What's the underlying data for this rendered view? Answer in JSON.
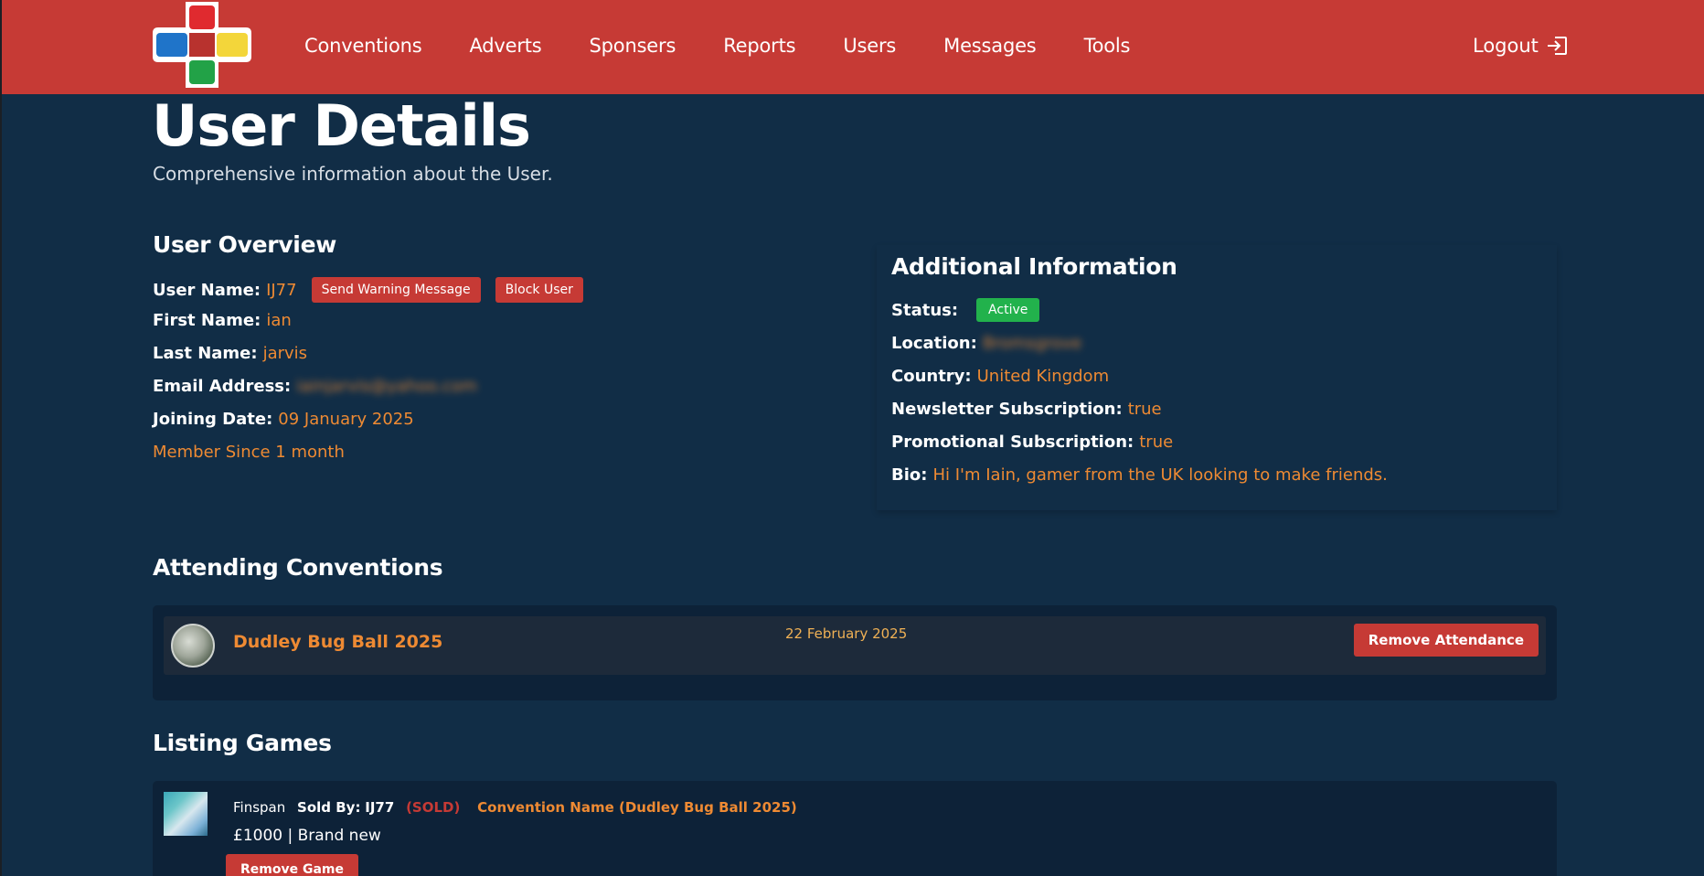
{
  "colors": {
    "header_bg": "#c63a35",
    "page_bg": "#112d46",
    "accent_orange": "#ee8a33",
    "active_green": "#22b24c",
    "button_red": "#c63a35"
  },
  "nav": {
    "items": [
      "Conventions",
      "Adverts",
      "Sponsers",
      "Reports",
      "Users",
      "Messages",
      "Tools"
    ],
    "logout_label": "Logout",
    "logout_icon": "logout-icon"
  },
  "page": {
    "title": "User Details",
    "subtitle": "Comprehensive information about the User."
  },
  "overview": {
    "heading": "User Overview",
    "username_label": "User Name:",
    "username": "IJ77",
    "send_warning_label": "Send Warning Message",
    "block_label": "Block User",
    "first_name_label": "First Name:",
    "first_name": "ian",
    "last_name_label": "Last Name:",
    "last_name": "jarvis",
    "email_label": "Email Address:",
    "email": "iainjarvis@yahoo.com",
    "joining_label": "Joining Date:",
    "joining_date": "09 January 2025",
    "member_since": "Member Since 1 month"
  },
  "additional": {
    "heading": "Additional Information",
    "status_label": "Status:",
    "status": "Active",
    "location_label": "Location:",
    "location": "Bromsgrove",
    "country_label": "Country:",
    "country": "United Kingdom",
    "newsletter_label": "Newsletter Subscription:",
    "newsletter": "true",
    "promo_label": "Promotional Subscription:",
    "promo": "true",
    "bio_label": "Bio:",
    "bio": "Hi I'm Iain, gamer from the UK looking to make friends."
  },
  "conventions": {
    "heading": "Attending Conventions",
    "items": [
      {
        "name": "Dudley Bug Ball 2025",
        "date": "22 February 2025",
        "remove_label": "Remove Attendance"
      }
    ]
  },
  "listing": {
    "heading": "Listing Games",
    "items": [
      {
        "name": "Finspan",
        "sold_by_label": "Sold By:",
        "seller": "IJ77",
        "sold_tag": "(SOLD)",
        "convention": "Convention Name (Dudley Bug Ball 2025)",
        "price": "£1000",
        "condition": "Brand new",
        "remove_label": "Remove Game"
      }
    ]
  }
}
